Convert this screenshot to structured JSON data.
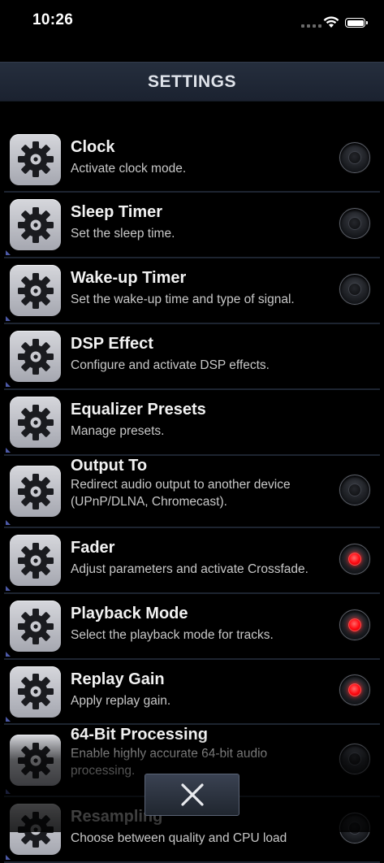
{
  "status": {
    "time": "10:26"
  },
  "header": {
    "title": "SETTINGS"
  },
  "settings": [
    {
      "title": "Clock",
      "subtitle": "Activate clock mode.",
      "toggle": "off"
    },
    {
      "title": "Sleep Timer",
      "subtitle": "Set the sleep time.",
      "toggle": "off"
    },
    {
      "title": "Wake-up Timer",
      "subtitle": "Set the wake-up time and type of signal.",
      "toggle": "off"
    },
    {
      "title": "DSP Effect",
      "subtitle": "Configure and activate DSP effects.",
      "toggle": "none"
    },
    {
      "title": "Equalizer Presets",
      "subtitle": "Manage presets.",
      "toggle": "none"
    },
    {
      "title": "Output To",
      "subtitle": "Redirect audio output to another device (UPnP/DLNA, Chromecast).",
      "toggle": "off"
    },
    {
      "title": "Fader",
      "subtitle": "Adjust parameters and activate Crossfade.",
      "toggle": "on"
    },
    {
      "title": "Playback Mode",
      "subtitle": "Select the playback mode for tracks.",
      "toggle": "on"
    },
    {
      "title": "Replay Gain",
      "subtitle": "Apply replay gain.",
      "toggle": "on"
    },
    {
      "title": "64-Bit Processing",
      "subtitle": "Enable highly accurate 64-bit audio processing.",
      "toggle": "off"
    },
    {
      "title": "Resampling",
      "subtitle": "Choose between quality and CPU load",
      "toggle": "off"
    }
  ],
  "icons": {
    "row_icon": "gear-icon",
    "close": "close-icon"
  },
  "colors": {
    "toggle_on": "#ff1a1a",
    "header_bg": "#1f2735"
  }
}
